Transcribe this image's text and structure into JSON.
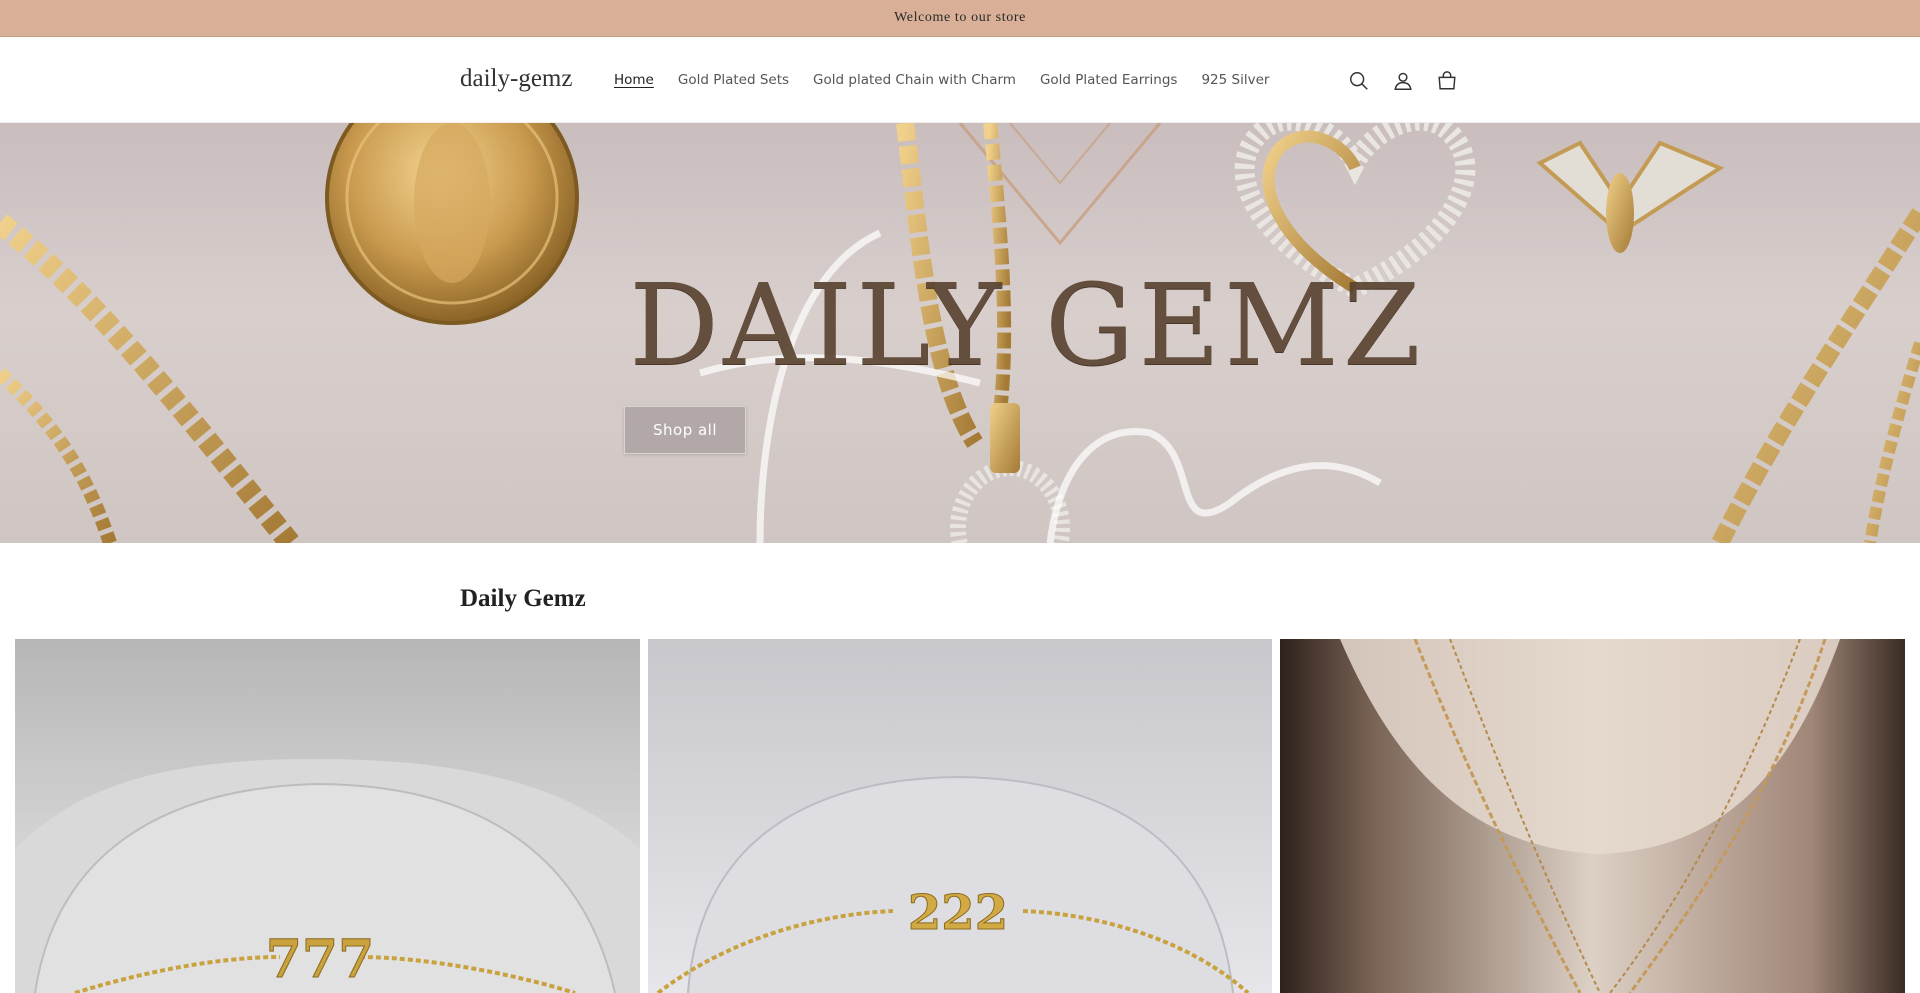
{
  "announcement": {
    "text": "Welcome to our store"
  },
  "header": {
    "logo": "daily-gemz",
    "nav": [
      {
        "label": "Home",
        "active": true
      },
      {
        "label": "Gold Plated Sets",
        "active": false
      },
      {
        "label": "Gold plated Chain with Charm",
        "active": false
      },
      {
        "label": "Gold Plated Earrings",
        "active": false
      },
      {
        "label": "925 Silver",
        "active": false
      }
    ],
    "icons": [
      "search-icon",
      "account-icon",
      "cart-icon"
    ]
  },
  "hero": {
    "title": "DAILY GEMZ",
    "button_label": "Shop all"
  },
  "collection": {
    "title": "Daily Gemz",
    "cards": [
      {
        "pendant_text": "777"
      },
      {
        "pendant_text": "222"
      },
      {
        "pendant_text": ""
      }
    ]
  },
  "colors": {
    "announcement_bg": "#d9af97",
    "gold": "#c9a23f",
    "hero_bg": "#d2c8c6"
  }
}
